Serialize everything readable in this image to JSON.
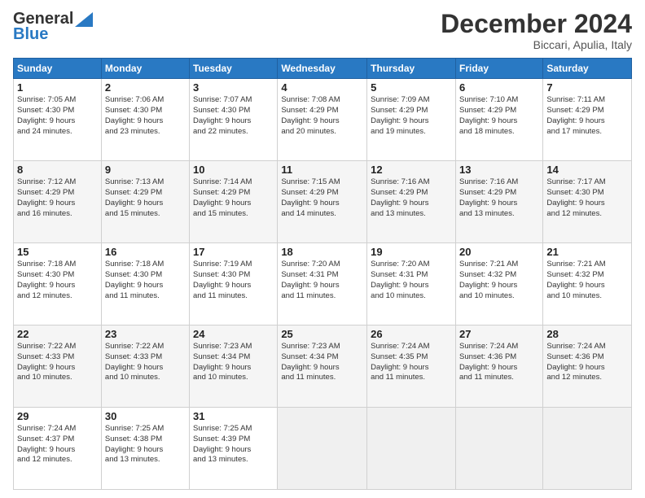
{
  "logo": {
    "general": "General",
    "blue": "Blue"
  },
  "title": "December 2024",
  "subtitle": "Biccari, Apulia, Italy",
  "days_header": [
    "Sunday",
    "Monday",
    "Tuesday",
    "Wednesday",
    "Thursday",
    "Friday",
    "Saturday"
  ],
  "weeks": [
    [
      {
        "day": "1",
        "info": "Sunrise: 7:05 AM\nSunset: 4:30 PM\nDaylight: 9 hours\nand 24 minutes."
      },
      {
        "day": "2",
        "info": "Sunrise: 7:06 AM\nSunset: 4:30 PM\nDaylight: 9 hours\nand 23 minutes."
      },
      {
        "day": "3",
        "info": "Sunrise: 7:07 AM\nSunset: 4:30 PM\nDaylight: 9 hours\nand 22 minutes."
      },
      {
        "day": "4",
        "info": "Sunrise: 7:08 AM\nSunset: 4:29 PM\nDaylight: 9 hours\nand 20 minutes."
      },
      {
        "day": "5",
        "info": "Sunrise: 7:09 AM\nSunset: 4:29 PM\nDaylight: 9 hours\nand 19 minutes."
      },
      {
        "day": "6",
        "info": "Sunrise: 7:10 AM\nSunset: 4:29 PM\nDaylight: 9 hours\nand 18 minutes."
      },
      {
        "day": "7",
        "info": "Sunrise: 7:11 AM\nSunset: 4:29 PM\nDaylight: 9 hours\nand 17 minutes."
      }
    ],
    [
      {
        "day": "8",
        "info": "Sunrise: 7:12 AM\nSunset: 4:29 PM\nDaylight: 9 hours\nand 16 minutes."
      },
      {
        "day": "9",
        "info": "Sunrise: 7:13 AM\nSunset: 4:29 PM\nDaylight: 9 hours\nand 15 minutes."
      },
      {
        "day": "10",
        "info": "Sunrise: 7:14 AM\nSunset: 4:29 PM\nDaylight: 9 hours\nand 15 minutes."
      },
      {
        "day": "11",
        "info": "Sunrise: 7:15 AM\nSunset: 4:29 PM\nDaylight: 9 hours\nand 14 minutes."
      },
      {
        "day": "12",
        "info": "Sunrise: 7:16 AM\nSunset: 4:29 PM\nDaylight: 9 hours\nand 13 minutes."
      },
      {
        "day": "13",
        "info": "Sunrise: 7:16 AM\nSunset: 4:29 PM\nDaylight: 9 hours\nand 13 minutes."
      },
      {
        "day": "14",
        "info": "Sunrise: 7:17 AM\nSunset: 4:30 PM\nDaylight: 9 hours\nand 12 minutes."
      }
    ],
    [
      {
        "day": "15",
        "info": "Sunrise: 7:18 AM\nSunset: 4:30 PM\nDaylight: 9 hours\nand 12 minutes."
      },
      {
        "day": "16",
        "info": "Sunrise: 7:18 AM\nSunset: 4:30 PM\nDaylight: 9 hours\nand 11 minutes."
      },
      {
        "day": "17",
        "info": "Sunrise: 7:19 AM\nSunset: 4:30 PM\nDaylight: 9 hours\nand 11 minutes."
      },
      {
        "day": "18",
        "info": "Sunrise: 7:20 AM\nSunset: 4:31 PM\nDaylight: 9 hours\nand 11 minutes."
      },
      {
        "day": "19",
        "info": "Sunrise: 7:20 AM\nSunset: 4:31 PM\nDaylight: 9 hours\nand 10 minutes."
      },
      {
        "day": "20",
        "info": "Sunrise: 7:21 AM\nSunset: 4:32 PM\nDaylight: 9 hours\nand 10 minutes."
      },
      {
        "day": "21",
        "info": "Sunrise: 7:21 AM\nSunset: 4:32 PM\nDaylight: 9 hours\nand 10 minutes."
      }
    ],
    [
      {
        "day": "22",
        "info": "Sunrise: 7:22 AM\nSunset: 4:33 PM\nDaylight: 9 hours\nand 10 minutes."
      },
      {
        "day": "23",
        "info": "Sunrise: 7:22 AM\nSunset: 4:33 PM\nDaylight: 9 hours\nand 10 minutes."
      },
      {
        "day": "24",
        "info": "Sunrise: 7:23 AM\nSunset: 4:34 PM\nDaylight: 9 hours\nand 10 minutes."
      },
      {
        "day": "25",
        "info": "Sunrise: 7:23 AM\nSunset: 4:34 PM\nDaylight: 9 hours\nand 11 minutes."
      },
      {
        "day": "26",
        "info": "Sunrise: 7:24 AM\nSunset: 4:35 PM\nDaylight: 9 hours\nand 11 minutes."
      },
      {
        "day": "27",
        "info": "Sunrise: 7:24 AM\nSunset: 4:36 PM\nDaylight: 9 hours\nand 11 minutes."
      },
      {
        "day": "28",
        "info": "Sunrise: 7:24 AM\nSunset: 4:36 PM\nDaylight: 9 hours\nand 12 minutes."
      }
    ],
    [
      {
        "day": "29",
        "info": "Sunrise: 7:24 AM\nSunset: 4:37 PM\nDaylight: 9 hours\nand 12 minutes."
      },
      {
        "day": "30",
        "info": "Sunrise: 7:25 AM\nSunset: 4:38 PM\nDaylight: 9 hours\nand 13 minutes."
      },
      {
        "day": "31",
        "info": "Sunrise: 7:25 AM\nSunset: 4:39 PM\nDaylight: 9 hours\nand 13 minutes."
      },
      {
        "day": "",
        "info": ""
      },
      {
        "day": "",
        "info": ""
      },
      {
        "day": "",
        "info": ""
      },
      {
        "day": "",
        "info": ""
      }
    ]
  ]
}
